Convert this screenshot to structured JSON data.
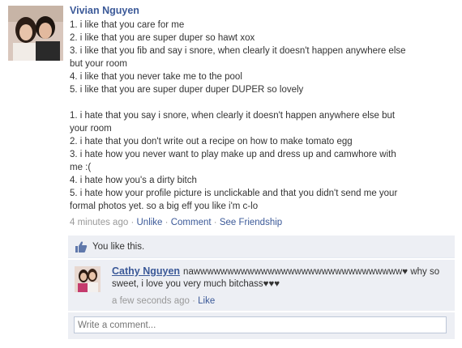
{
  "post": {
    "author": "Vivian Nguyen",
    "lines": [
      "1. i like that you care for me",
      "2. i like that you are super duper so hawt xox",
      "3. i like that you fib and say i snore, when clearly it doesn't happen anywhere else",
      "but your room",
      "4. i like that you never take me to the pool",
      "5. i like that you are super duper duper DUPER so lovely",
      "",
      "1. i hate that you say i snore, when clearly it doesn't happen anywhere else but",
      "your room",
      "2. i hate that you don't write out a recipe on how to make tomato egg",
      "3. i hate how you never want to play make up and dress up and camwhore with",
      "me :(",
      "4. i hate how you's a dirty bitch",
      "5. i hate how your profile picture is unclickable and that you didn't send me your",
      "formal photos yet. so a big eff you like i'm c-lo"
    ],
    "timestamp": "4 minutes ago",
    "unlike_label": "Unlike",
    "comment_label": "Comment",
    "friendship_label": "See Friendship",
    "separator": "·"
  },
  "likes": {
    "text": "You like this."
  },
  "comment": {
    "author": "Cathy Nguyen",
    "text": "nawwwwwwwwwwwwwwwwwwwwwwwwwwwwwww♥ why so sweet, i love you very much bitchass♥♥♥",
    "timestamp": "a few seconds ago",
    "like_label": "Like"
  },
  "composer": {
    "placeholder": "Write a comment..."
  },
  "colors": {
    "link": "#3b5998",
    "ufi_bg": "#edeff4",
    "meta": "#999999"
  }
}
